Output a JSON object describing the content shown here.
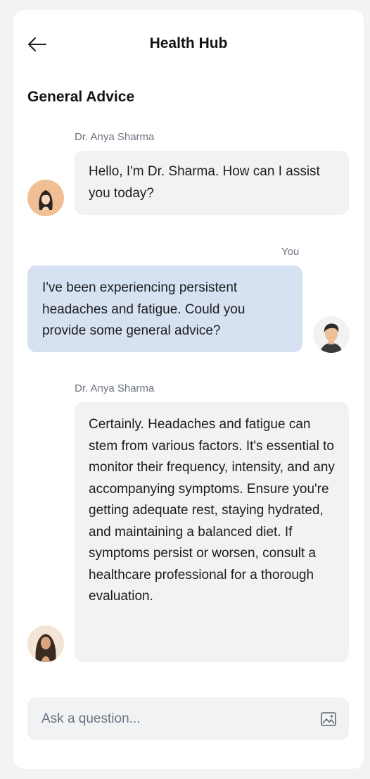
{
  "header": {
    "title": "Health Hub",
    "back_icon": "arrow-left-icon"
  },
  "section": {
    "title": "General Advice"
  },
  "messages": [
    {
      "sender": "Dr. Anya Sharma",
      "role": "doctor",
      "text": "Hello, I'm Dr. Sharma. How can I assist you today?"
    },
    {
      "sender": "You",
      "role": "user",
      "text": "I've been experiencing persistent headaches and fatigue. Could you provide some general advice?"
    },
    {
      "sender": "Dr. Anya Sharma",
      "role": "doctor",
      "text": "Certainly. Headaches and fatigue can stem from various factors. It's essential to monitor their frequency, intensity, and any accompanying symptoms. Ensure you're getting adequate rest, staying hydrated, and maintaining a balanced diet. If symptoms persist or worsen, consult a healthcare professional for a thorough evaluation."
    }
  ],
  "composer": {
    "placeholder": "Ask a question...",
    "value": "",
    "attach_icon": "image-icon"
  },
  "colors": {
    "doctor_bubble": "#f1f2f4",
    "user_bubble": "#d6e2f2",
    "text": "#1d1d1f",
    "muted": "#6b7280"
  }
}
